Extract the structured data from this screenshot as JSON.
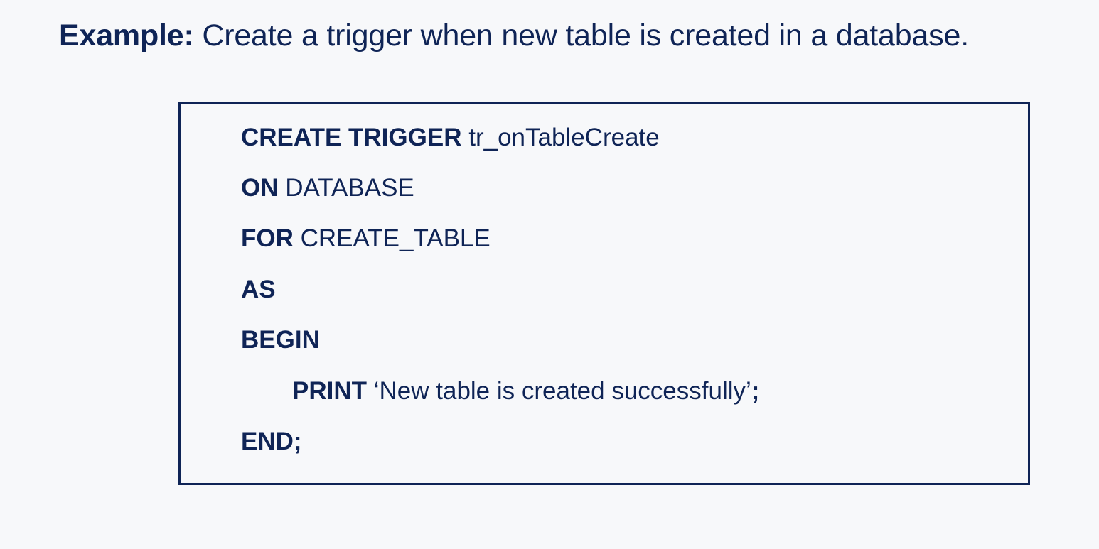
{
  "heading": {
    "label": "Example:",
    "text": "Create a trigger when new table is created in a database."
  },
  "code": {
    "lines": [
      {
        "keyword": "CREATE TRIGGER",
        "rest": "tr_onTableCreate"
      },
      {
        "keyword": "ON",
        "rest": "DATABASE"
      },
      {
        "keyword": "FOR",
        "rest": "CREATE_TABLE"
      },
      {
        "keyword": "AS",
        "rest": ""
      },
      {
        "keyword": "BEGIN",
        "rest": ""
      },
      {
        "keyword": "PRINT",
        "rest": "‘New table is created successfully’",
        "trail": ";"
      },
      {
        "keyword": "END;",
        "rest": ""
      }
    ]
  },
  "colors": {
    "text": "#0f2456",
    "background": "#f7f8fa"
  }
}
